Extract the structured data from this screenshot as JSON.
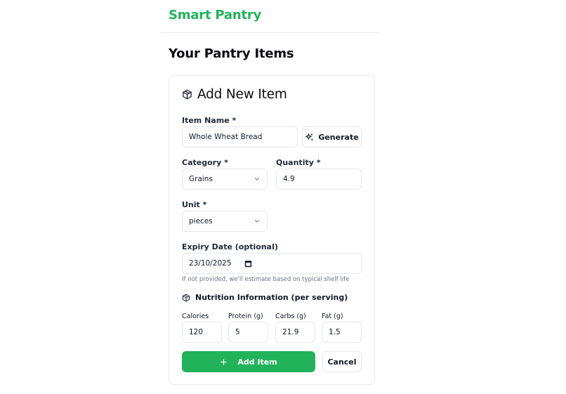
{
  "app": {
    "brand": "Smart Pantry"
  },
  "page": {
    "title": "Your Pantry Items"
  },
  "form": {
    "title": "Add New Item",
    "item_name_label": "Item Name *",
    "item_name_value": "Whole Wheat Bread",
    "generate_label": "Generate",
    "category_label": "Category *",
    "category_value": "Grains",
    "quantity_label": "Quantity *",
    "quantity_value": "4.9",
    "unit_label": "Unit *",
    "unit_value": "pieces",
    "expiry_label": "Expiry Date (optional)",
    "expiry_value": "23/10/2025",
    "expiry_hint": "If not provided, we'll estimate based on typical shelf life",
    "nutrition_title": "Nutrition Information (per serving)",
    "nutrition": {
      "calories_label": "Calories",
      "calories_value": "120",
      "protein_label": "Protein (g)",
      "protein_value": "5",
      "carbs_label": "Carbs (g)",
      "carbs_value": "21.9",
      "fat_label": "Fat (g)",
      "fat_value": "1.5"
    },
    "add_label": "Add Item",
    "cancel_label": "Cancel"
  },
  "colors": {
    "brand": "#22b35a",
    "border": "#e5e7eb",
    "muted": "#6b7280"
  },
  "icons": {
    "form_title": "package-icon",
    "generate": "sparkles-icon",
    "select": "chevron-down-icon",
    "date": "calendar-icon",
    "nutrition": "package-icon",
    "add": "plus-icon"
  }
}
